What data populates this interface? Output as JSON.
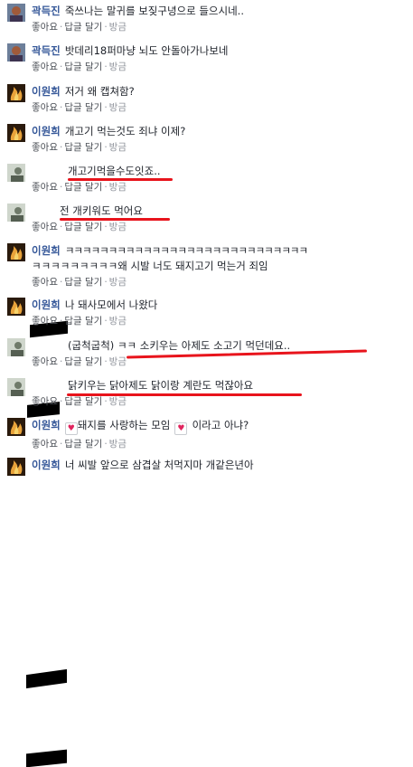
{
  "actions": {
    "like": "좋아요",
    "reply": "답글 달기",
    "time": "방금"
  },
  "comments": [
    {
      "name": "곽득진",
      "text": "죽쓰나는 말귀를 보짖구녕으로 들으시네.."
    },
    {
      "name": "곽득진",
      "text": "밧데리18퍼마냥 뇌도 안돌아가나보네"
    },
    {
      "name": "이원희",
      "text": "저거 왜 캡쳐함?"
    },
    {
      "name": "이원희",
      "text": "개고기 먹는것도 죄냐 이제?"
    },
    {
      "name": "",
      "text": "개고기먹을수도잇죠.."
    },
    {
      "name": "",
      "text": "전 개키워도 먹어요"
    },
    {
      "name": "이원희",
      "text": "ㅋㅋㅋㅋㅋㅋㅋㅋㅋㅋㅋㅋㅋㅋㅋㅋㅋㅋㅋㅋㅋㅋㅋㅋㅋㅋㅋㅋ",
      "text2": "ㅋㅋㅋㅋㅋㅋㅋㅋㅋ왜 시발 너도 돼지고기 먹는거 죄임"
    },
    {
      "name": "이원희",
      "text": "나 돼사모에서 나왔다"
    },
    {
      "name": "",
      "text": "(굽척굽척) ㅋㅋ 소키우는 아제도 소고기 먹던데요.."
    },
    {
      "name": "",
      "text": "닭키우는 닭아제도 닭이랑 계란도 먹잖아요"
    },
    {
      "name": "이원희",
      "text_before": "",
      "heart": "♥",
      "text": "돼지를 사랑하는 모임",
      "text_after": "이라고 아냐?"
    },
    {
      "name": "이원희",
      "text": "너 씨발 앞으로 삼겹살 처먹지마 개같은년아"
    }
  ]
}
